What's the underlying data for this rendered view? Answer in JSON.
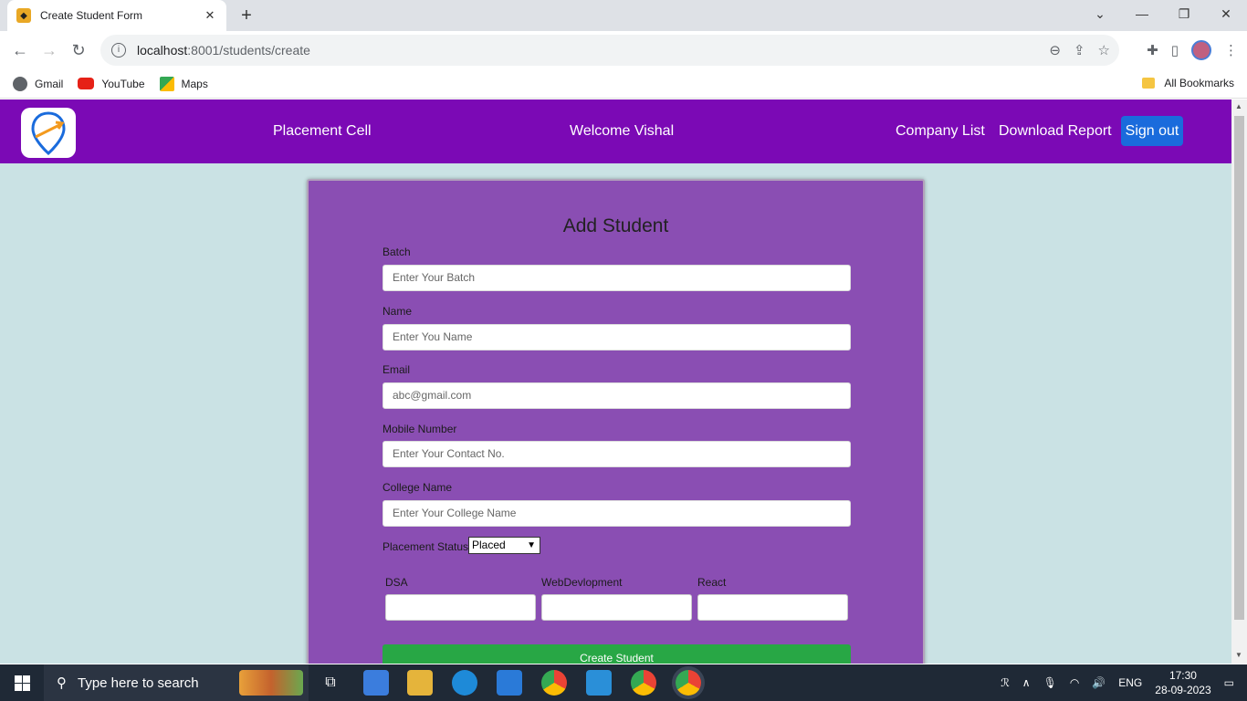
{
  "browser": {
    "tab_title": "Create Student Form",
    "url_host": "localhost",
    "url_path": ":8001/students/create",
    "bookmarks": [
      "Gmail",
      "YouTube",
      "Maps"
    ],
    "all_bookmarks": "All Bookmarks"
  },
  "navbar": {
    "brand": "Placement Cell",
    "welcome": "Welcome Vishal",
    "company_list": "Company List",
    "download_report": "Download Report",
    "sign_out": "Sign out"
  },
  "form": {
    "title": "Add Student",
    "fields": [
      {
        "label": "Batch",
        "placeholder": "Enter Your Batch"
      },
      {
        "label": "Name",
        "placeholder": "Enter You Name"
      },
      {
        "label": "Email",
        "placeholder": "abc@gmail.com"
      },
      {
        "label": "Mobile Number",
        "placeholder": "Enter Your Contact No."
      },
      {
        "label": "College Name",
        "placeholder": "Enter Your College Name"
      }
    ],
    "placement_status_label": "Placement Status",
    "placement_status_value": "Placed",
    "scores": [
      "DSA",
      "WebDevlopment",
      "React"
    ],
    "submit": "Create Student"
  },
  "taskbar": {
    "search_placeholder": "Type here to search",
    "language": "ENG",
    "time": "17:30",
    "date": "28-09-2023"
  },
  "colors": {
    "navbar": "#7b09b5",
    "card": "#8a4eb3",
    "page_bg": "#cae2e4",
    "submit": "#28a745",
    "sign_out": "#1a6bdc"
  }
}
